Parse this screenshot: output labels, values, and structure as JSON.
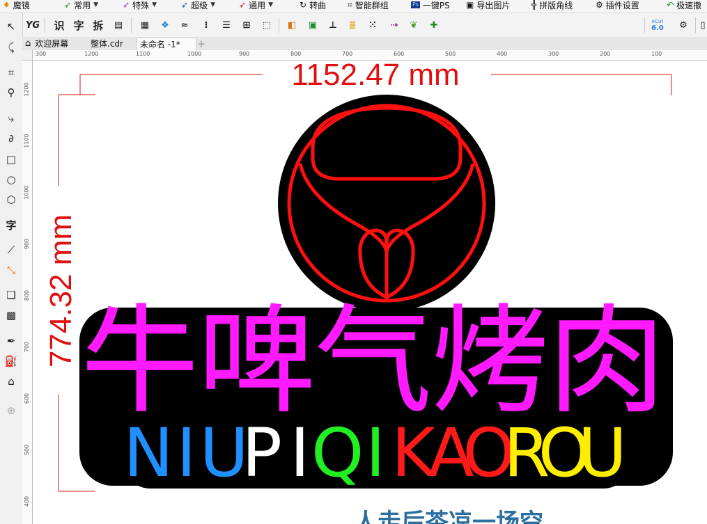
{
  "menubar": {
    "items": [
      {
        "label": "魔镜",
        "icon": "magic-mirror-icon",
        "color": "#e8890c"
      },
      {
        "label": "常用",
        "icon": "arrow-icon",
        "color": "#1a8f2a"
      },
      {
        "label": "特殊",
        "icon": "arrow-icon",
        "color": "#8a2be2"
      },
      {
        "label": "超级",
        "icon": "arrow-icon",
        "color": "#1f4fbf"
      },
      {
        "label": "通用",
        "icon": "arrow-icon",
        "color": "#d01010"
      },
      {
        "label": "转曲",
        "icon": "convert-curve-icon",
        "color": "#222222"
      },
      {
        "label": "智能群组",
        "icon": "smart-group-icon",
        "color": "#222222"
      },
      {
        "label": "一键PS",
        "icon": "photoshop-icon",
        "color": "#1b3a8f"
      },
      {
        "label": "导出图片",
        "icon": "image-export-icon",
        "color": "#222222"
      },
      {
        "label": "拼版角线",
        "icon": "corner-marks-icon",
        "color": "#222222"
      },
      {
        "label": "插件设置",
        "icon": "gear-icon",
        "color": "#222222"
      },
      {
        "label": "极速撤",
        "icon": "undo-icon",
        "color": "#1a8f2a"
      }
    ]
  },
  "toolbar": {
    "text_tools": [
      "识",
      "字",
      "拆"
    ],
    "version_badge_top": "eCut",
    "version_badge_bottom": "6.0"
  },
  "tabs": [
    {
      "label": "欢迎屏幕",
      "active": false
    },
    {
      "label": "整体.cdr",
      "active": false
    },
    {
      "label": "未命名 -1*",
      "active": true
    }
  ],
  "rulers": {
    "top": [
      "300",
      "1200",
      "1100",
      "1000",
      "900",
      "800",
      "700",
      "600",
      "500",
      "400",
      "300",
      "200",
      "100"
    ],
    "left": [
      "1200",
      "1100",
      "1000",
      "900",
      "800",
      "700",
      "600",
      "500",
      "400"
    ]
  },
  "design": {
    "width_label": "1152.47 mm",
    "height_label": "774.32 mm",
    "dimension_color": "#e01010",
    "title_cn": "牛啤气烤肉",
    "title_cn_color": "#ff1aff",
    "subtitle_letters": [
      {
        "char": "N",
        "color": "#1e90ff"
      },
      {
        "char": "I",
        "color": "#1e90ff"
      },
      {
        "char": "U",
        "color": "#1e90ff"
      },
      {
        "char": "P",
        "color": "#ffffff"
      },
      {
        "char": "I",
        "color": "#ffffff"
      },
      {
        "char": "Q",
        "color": "#22ee22"
      },
      {
        "char": "I",
        "color": "#22ee22"
      },
      {
        "char": "K",
        "color": "#ff1a1a"
      },
      {
        "char": "A",
        "color": "#ff1a1a"
      },
      {
        "char": "O",
        "color": "#ff1a1a"
      },
      {
        "char": "R",
        "color": "#ffee00"
      },
      {
        "char": "O",
        "color": "#ffee00"
      },
      {
        "char": "U",
        "color": "#ffee00"
      }
    ],
    "logo_color": "#ff1010",
    "footer_text": "人走后茶凉一场空",
    "footer_color": "#2a6fa0"
  }
}
